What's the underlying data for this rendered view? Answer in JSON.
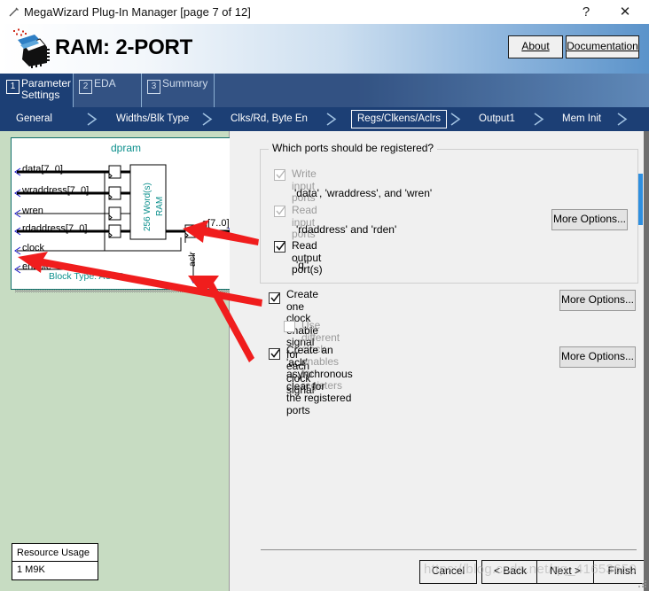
{
  "window": {
    "title": "MegaWizard Plug-In Manager [page 7 of 12]",
    "icon": "wizard-wand-icon",
    "help_label": "?",
    "close_label": "✕"
  },
  "header": {
    "brand_title": "RAM: 2-PORT",
    "logo": "altera-chip-logo",
    "about_label": "About",
    "documentation_label": "Documentation",
    "accent_blue": "#1c3f75"
  },
  "tabs": [
    {
      "num": "1",
      "label": "Parameter Settings",
      "active": true
    },
    {
      "num": "2",
      "label": "EDA",
      "active": false
    },
    {
      "num": "3",
      "label": "Summary",
      "active": false
    }
  ],
  "breadcrumbs": [
    {
      "label": "General",
      "selected": false
    },
    {
      "label": "Widths/Blk Type",
      "selected": false
    },
    {
      "label": "Clks/Rd, Byte En",
      "selected": false
    },
    {
      "label": "Regs/Clkens/Aclrs",
      "selected": true
    },
    {
      "label": "Output1",
      "selected": false
    },
    {
      "label": "Mem Init",
      "selected": false
    }
  ],
  "diagram": {
    "module_name": "dpram",
    "ram_label_1": "256 Word(s)",
    "ram_label_2": "RAM",
    "block_type_text": "Block Type: AUTO",
    "aclr_label": "aclr",
    "inputs": [
      "data[7..0]",
      "wraddress[7..0]",
      "wren",
      "rdaddress[7..0]",
      "clock",
      "enable"
    ],
    "outputs": [
      "q[7..0]"
    ],
    "teal": "#0b8f8c",
    "panel_green": "#c7dcc2"
  },
  "resource_usage": {
    "header": "Resource Usage",
    "value": "1 M9K"
  },
  "options": {
    "group_legend": "Which ports should be registered?",
    "items": [
      {
        "label": "Write input ports",
        "checked": true,
        "disabled": true,
        "detail": "'data', 'wraddress', and 'wren'"
      },
      {
        "label": "Read input ports",
        "checked": true,
        "disabled": true,
        "detail": "'rdaddress' and 'rden'"
      },
      {
        "label": "Read output port(s)",
        "checked": true,
        "disabled": false,
        "detail": "'q'"
      }
    ],
    "group_more_options": "More Options...",
    "clock_enable": {
      "label": "Create one clock enable signal for each\nclock signal",
      "checked": true,
      "disabled": false,
      "more_options": "More Options..."
    },
    "different_clock_enables": {
      "label": "Use different clock enables for registers",
      "checked": false,
      "disabled": true
    },
    "aclr": {
      "label": "Create an 'aclr' asynchronous clear for\n the registered ports",
      "checked": true,
      "disabled": false,
      "more_options": "More Options..."
    }
  },
  "navigation": {
    "cancel": "Cancel",
    "back": "< Back",
    "next": "Next >",
    "finish": "Finish"
  },
  "watermark": {
    "text": "https://blog.csdn.net/qq_41653650"
  }
}
